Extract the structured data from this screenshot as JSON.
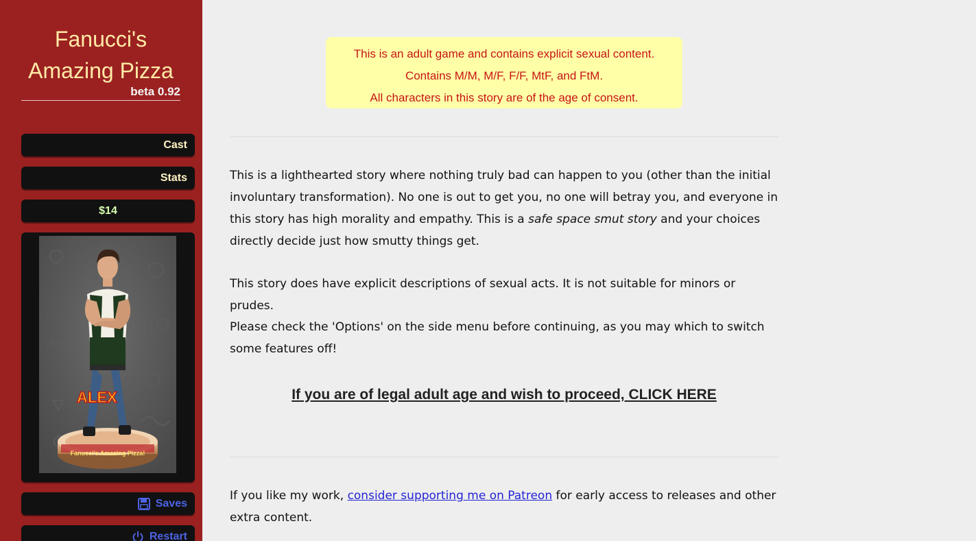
{
  "sidebar": {
    "title": "Fanucci's Amazing Pizza",
    "version": "beta 0.92",
    "cast_label": "Cast",
    "stats_label": "Stats",
    "money": "$14",
    "portrait": {
      "character_name": "ALEX",
      "base_text": "Fanucci's Amazing Pizza!"
    },
    "saves_label": "Saves",
    "saves_icon": "floppy-disk-icon",
    "restart_label": "Restart",
    "restart_icon": "power-icon"
  },
  "warning": {
    "line1": "This is an adult game and contains explicit sexual content.",
    "line2": "Contains M/M, M/F, F/F, MtF, and FtM.",
    "line3": "All characters in this story are of the age of consent."
  },
  "main": {
    "intro_before": "This is a lighthearted story where nothing truly bad can happen to you (other than the initial involuntary transformation). No one is out to get you, no one will betray you, and everyone in this story has high morality and empathy. This is a ",
    "intro_emphasis": "safe space smut story",
    "intro_after": " and your choices directly decide just how smutty things get.",
    "explicit_note": "This story does have explicit descriptions of sexual acts. It is not suitable for minors or prudes.",
    "options_note": "Please check the 'Options' on the side menu before continuing, as you may which to switch some features off!",
    "proceed_link": "If you are of legal adult age and wish to proceed, CLICK HERE",
    "patreon_before": "If you like my work, ",
    "patreon_link": "consider supporting me on Patreon",
    "patreon_after": " for early access to releases and other extra content."
  },
  "colors": {
    "sidebar_bg": "#9b2121",
    "title": "#ffeaa6",
    "warning_bg": "#ffffa8",
    "warning_text": "#c81414",
    "button_bg": "#111111",
    "money_text": "#d6ffb0",
    "accent_blue": "#4c63e6"
  }
}
